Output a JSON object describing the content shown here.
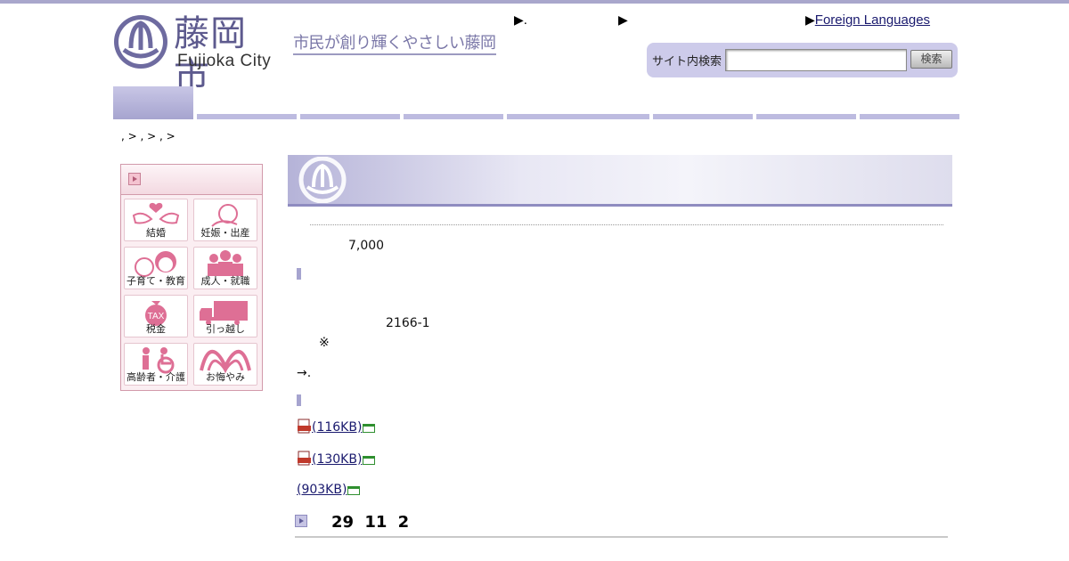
{
  "header": {
    "logo_name": "藤岡市",
    "logo_en": "Fujioka  City",
    "slogan": "市民が創り輝くやさしい藤岡",
    "links": [
      {
        "arrow": "▶",
        "label": "."
      },
      {
        "arrow": "▶",
        "label": ""
      },
      {
        "arrow": "▶",
        "label": "Foreign Languages"
      }
    ],
    "search": {
      "label": "サイト内検索",
      "value": "",
      "button": "検索"
    }
  },
  "breadcrumb": ", > , > , >",
  "sidebar": {
    "items": [
      {
        "label": "結婚",
        "icon": "wedding-icon"
      },
      {
        "label": "妊娠・出産",
        "icon": "baby-icon"
      },
      {
        "label": "子育て・教育",
        "icon": "child-icon"
      },
      {
        "label": "成人・就職",
        "icon": "people-icon"
      },
      {
        "label": "税金",
        "icon": "tax-icon",
        "badge": "TAX"
      },
      {
        "label": "引っ越し",
        "icon": "truck-icon"
      },
      {
        "label": "高齢者・介護",
        "icon": "wheelchair-icon"
      },
      {
        "label": "お悔やみ",
        "icon": "mountain-icon"
      }
    ]
  },
  "main": {
    "amount": "7,000",
    "address": "2166-1",
    "note": "※",
    "arrow_text": "→.",
    "files": [
      {
        "label": "(116KB)",
        "pdf": true
      },
      {
        "label": "(130KB)",
        "pdf": true
      },
      {
        "label": "(903KB)",
        "pdf": false
      }
    ],
    "date": "29  11  2"
  },
  "colors": {
    "accent": "#a6a4cf",
    "sidebar_border": "#d29aab",
    "icon_pink": "#de6f95"
  }
}
